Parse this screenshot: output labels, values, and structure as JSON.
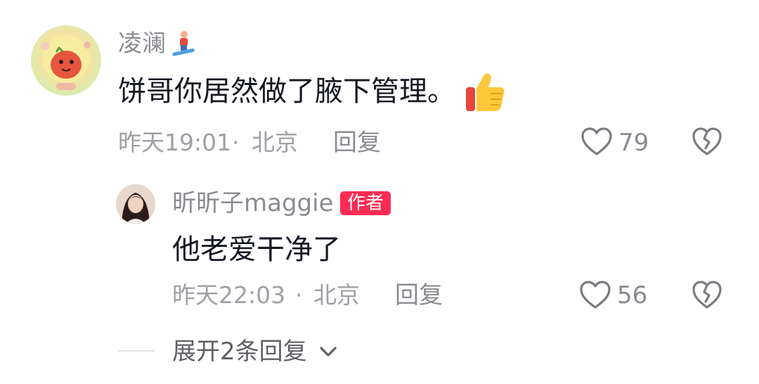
{
  "comments": [
    {
      "username": "凌澜",
      "username_icon": "snowboard-emoji",
      "text": "饼哥你居然做了腋下管理。",
      "text_emoji": "thumbs-up-emoji",
      "time": "昨天19:01",
      "separator": "·",
      "location": "北京",
      "reply_label": "回复",
      "likes": "79"
    }
  ],
  "replies": [
    {
      "username": "昕昕子maggie",
      "badge": "作者",
      "text": "他老爱干净了",
      "time": "昨天22:03",
      "separator": "·",
      "location": "北京",
      "reply_label": "回复",
      "likes": "56"
    }
  ],
  "expand": {
    "label": "展开2条回复",
    "icon": "chevron-down-icon"
  },
  "colors": {
    "badge": "#fe2c55",
    "secondary_text": "#8a8b91",
    "primary_text": "#161823"
  }
}
